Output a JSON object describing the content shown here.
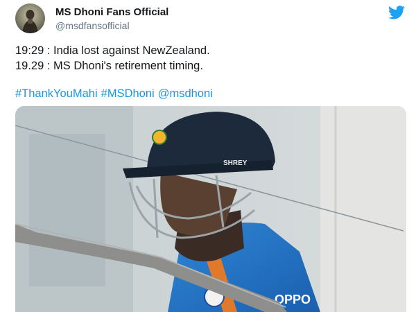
{
  "tweet": {
    "display_name": "MS Dhoni Fans Official",
    "handle": "@msdfansofficial",
    "lines": [
      "19:29 : India lost against NewZealand.",
      "19.29 : MS Dhoni's retirement timing."
    ],
    "hashtags": [
      "#ThankYouMahi",
      "#MSDhoni",
      "@msdhoni"
    ]
  },
  "media": {
    "helmet_text": "SHREY",
    "jersey_text": "OPPO"
  },
  "icons": {
    "platform": "twitter-bird-icon",
    "avatar": "avatar-photo"
  },
  "colors": {
    "link": "#1b95e0",
    "twitter_blue": "#1da1f2",
    "name": "#14171a",
    "handle": "#657786",
    "jersey": "#1f6fc4",
    "helmet": "#1c2a3c"
  }
}
